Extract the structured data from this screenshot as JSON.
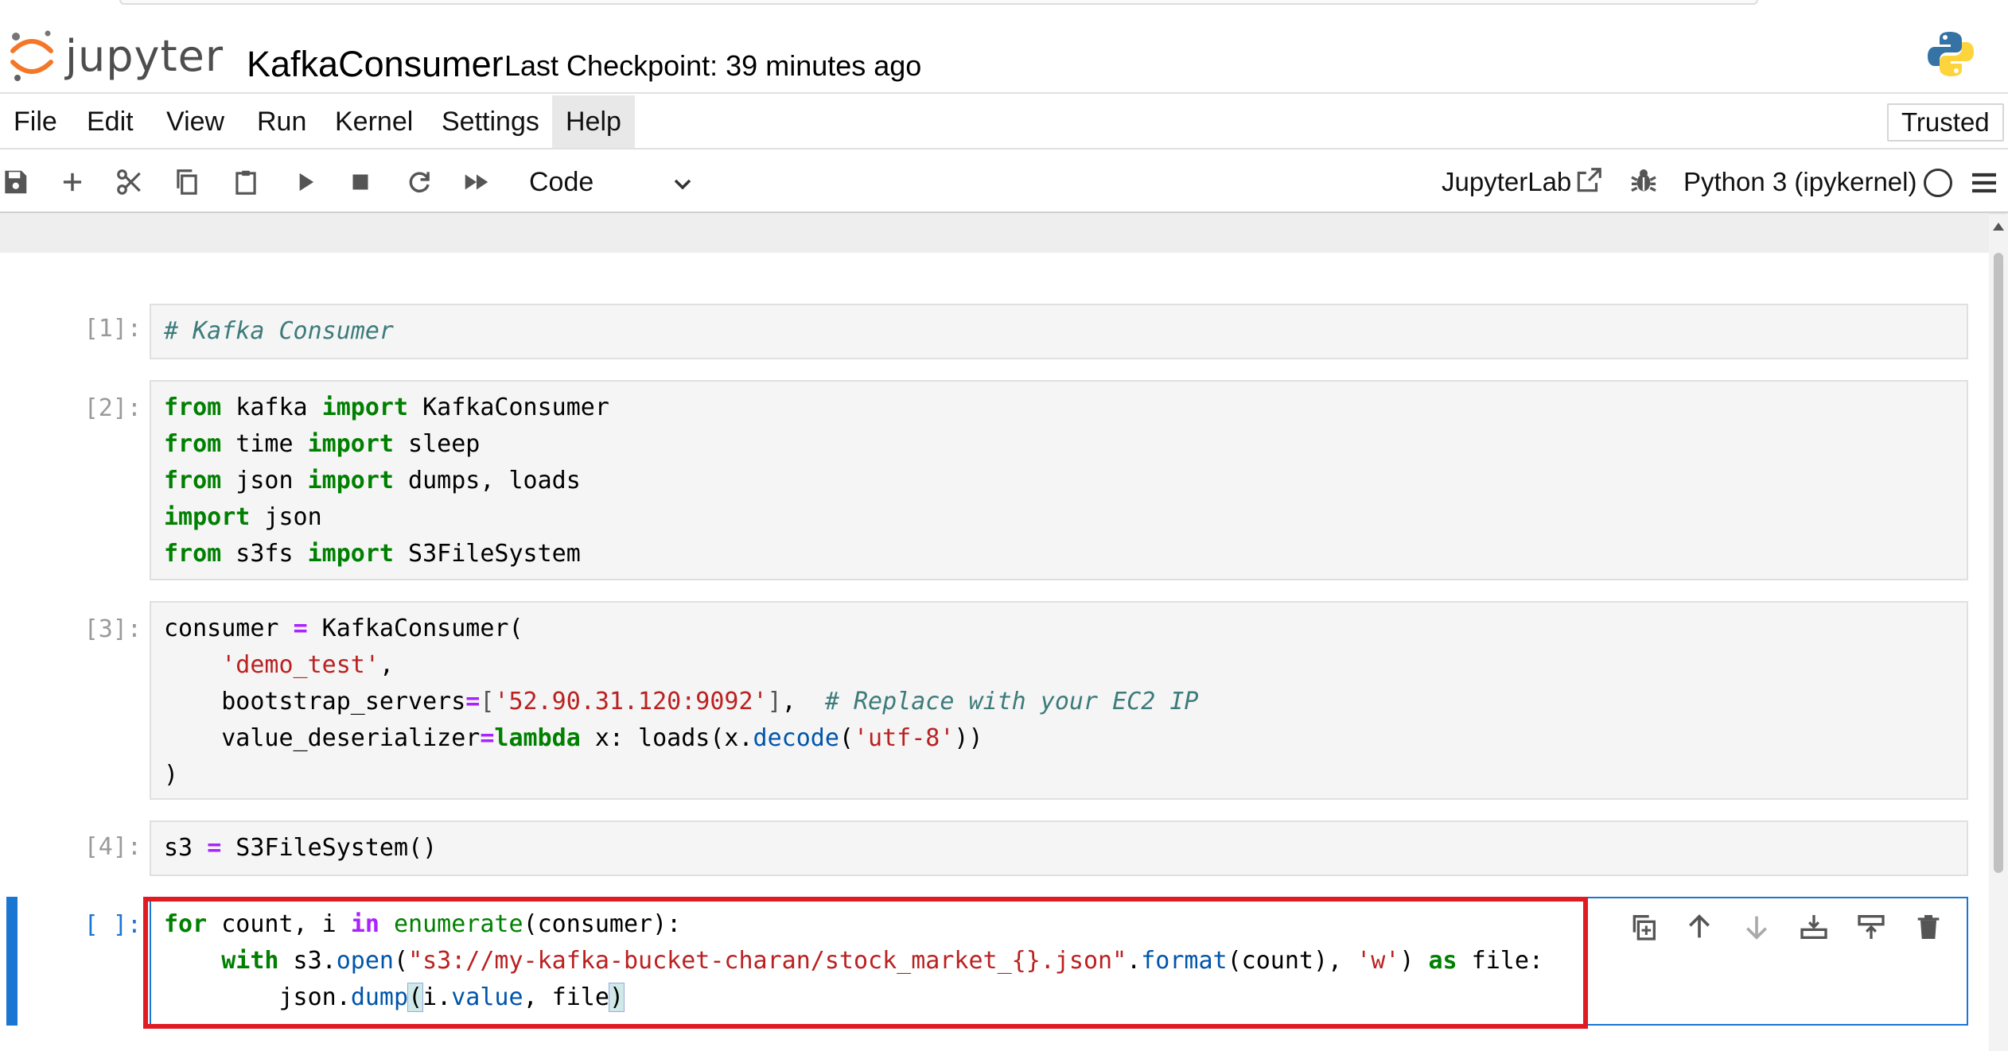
{
  "header": {
    "logo_text": "jupyter",
    "notebook_title": "KafkaConsumer",
    "checkpoint": "Last Checkpoint: 39 minutes ago",
    "kernel_logo_icon": "python-logo-icon"
  },
  "menu": {
    "items": [
      "File",
      "Edit",
      "View",
      "Run",
      "Kernel",
      "Settings",
      "Help"
    ],
    "active": "Help",
    "trusted_label": "Trusted"
  },
  "toolbar": {
    "icons": [
      "save-icon",
      "add-cell-icon",
      "cut-icon",
      "copy-icon",
      "paste-icon",
      "run-icon",
      "stop-icon",
      "restart-icon",
      "fast-forward-icon"
    ],
    "cell_type": "Code",
    "jupyterlab_label": "JupyterLab",
    "kernel_name": "Python 3 (ipykernel)"
  },
  "cells": [
    {
      "prompt": "[1]:",
      "lines": [
        "# Kafka Consumer"
      ]
    },
    {
      "prompt": "[2]:",
      "lines": [
        "from kafka import KafkaConsumer",
        "from time import sleep",
        "from json import dumps, loads",
        "import json",
        "from s3fs import S3FileSystem"
      ]
    },
    {
      "prompt": "[3]:",
      "lines": [
        "consumer = KafkaConsumer(",
        "    'demo_test',",
        "    bootstrap_servers=['52.90.31.120:9092'],  # Replace with your EC2 IP",
        "    value_deserializer=lambda x: loads(x.decode('utf-8'))",
        ")"
      ]
    },
    {
      "prompt": "[4]:",
      "lines": [
        "s3 = S3FileSystem()"
      ]
    },
    {
      "prompt": "[ ]:",
      "lines": [
        "for count, i in enumerate(consumer):",
        "    with s3.open(\"s3://my-kafka-bucket-charan/stock_market_{}.json\".format(count), 'w') as file:",
        "        json.dump(i.value, file)"
      ],
      "active": true
    }
  ],
  "cell_toolbar_icons": [
    "duplicate-cell-icon",
    "move-up-icon",
    "move-down-icon",
    "insert-below-icon",
    "insert-above-icon",
    "delete-cell-icon"
  ],
  "colors": {
    "accent": "#1976d2",
    "highlight_box": "#e01b24",
    "keyword": "#008000",
    "string": "#ba2121",
    "comment": "#3d7b7b"
  }
}
